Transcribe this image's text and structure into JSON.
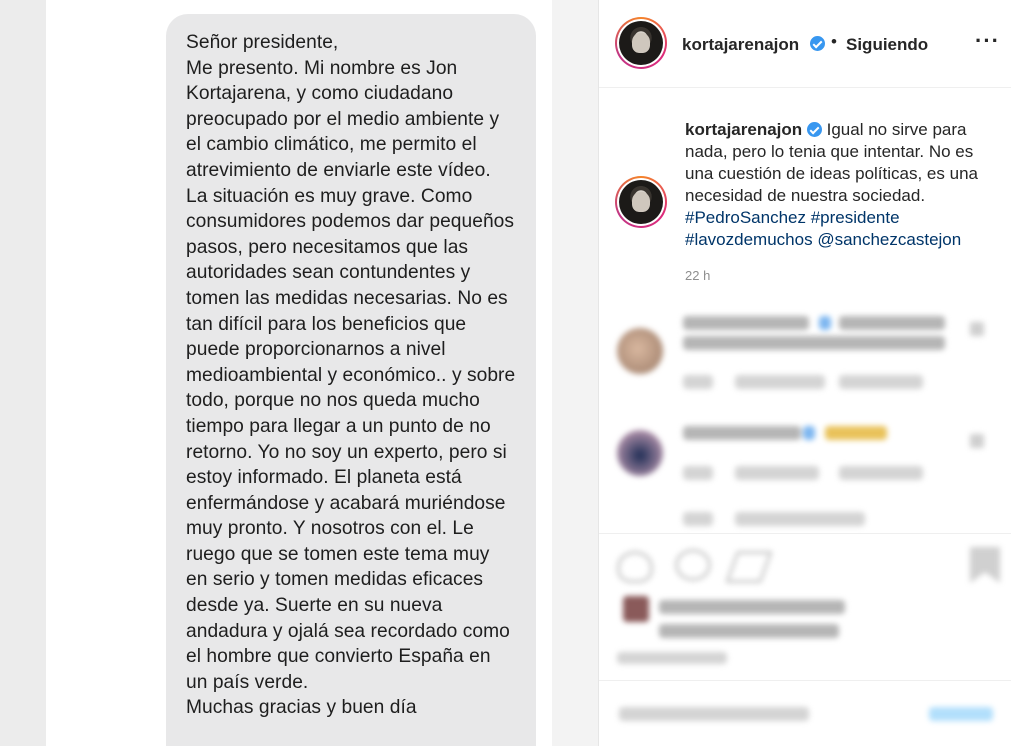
{
  "message": {
    "text": "Señor presidente,\nMe presento. Mi nombre es Jon Kortajarena, y como ciudadano preocupado por el medio ambiente y el cambio climático, me permito el atrevimiento de enviarle este vídeo. La situación es muy grave. Como consumidores podemos dar pequeños pasos, pero necesitamos que las autoridades sean contundentes y tomen las medidas necesarias. No es tan difícil para los beneficios que puede proporcionarnos a nivel medioambiental y económico.. y sobre todo, porque no nos queda mucho tiempo para llegar a un punto de no retorno. Yo no soy un experto, pero si estoy informado. El planeta está enfermándose y acabará muriéndose muy pronto. Y nosotros con el. Le ruego que se tomen este tema muy en serio y tomen medidas eficaces desde ya. Suerte en su nueva andadura y ojalá sea recordado como el hombre que convierto España en un país verde.\nMuchas gracias y buen día"
  },
  "header": {
    "username": "kortajarenajon",
    "separator": "•",
    "follow_status": "Siguiendo",
    "more_icon": "more-horizontal-icon"
  },
  "caption": {
    "username": "kortajarenajon",
    "text": "Igual no sirve para nada, pero lo tenia que intentar. No es una cuestión de ideas políticas, es una necesidad de nuestra sociedad.",
    "hashtag_1": "#PedroSanchez",
    "hashtag_2": "#presidente",
    "hashtag_3": "#lavozdemuchos",
    "mention": "@sanchezcastejon",
    "time": "22 h"
  },
  "colors": {
    "verified": "#3897f0",
    "link": "#003569",
    "muted": "#8e8e8e",
    "bubble": "#e8e8e9"
  }
}
